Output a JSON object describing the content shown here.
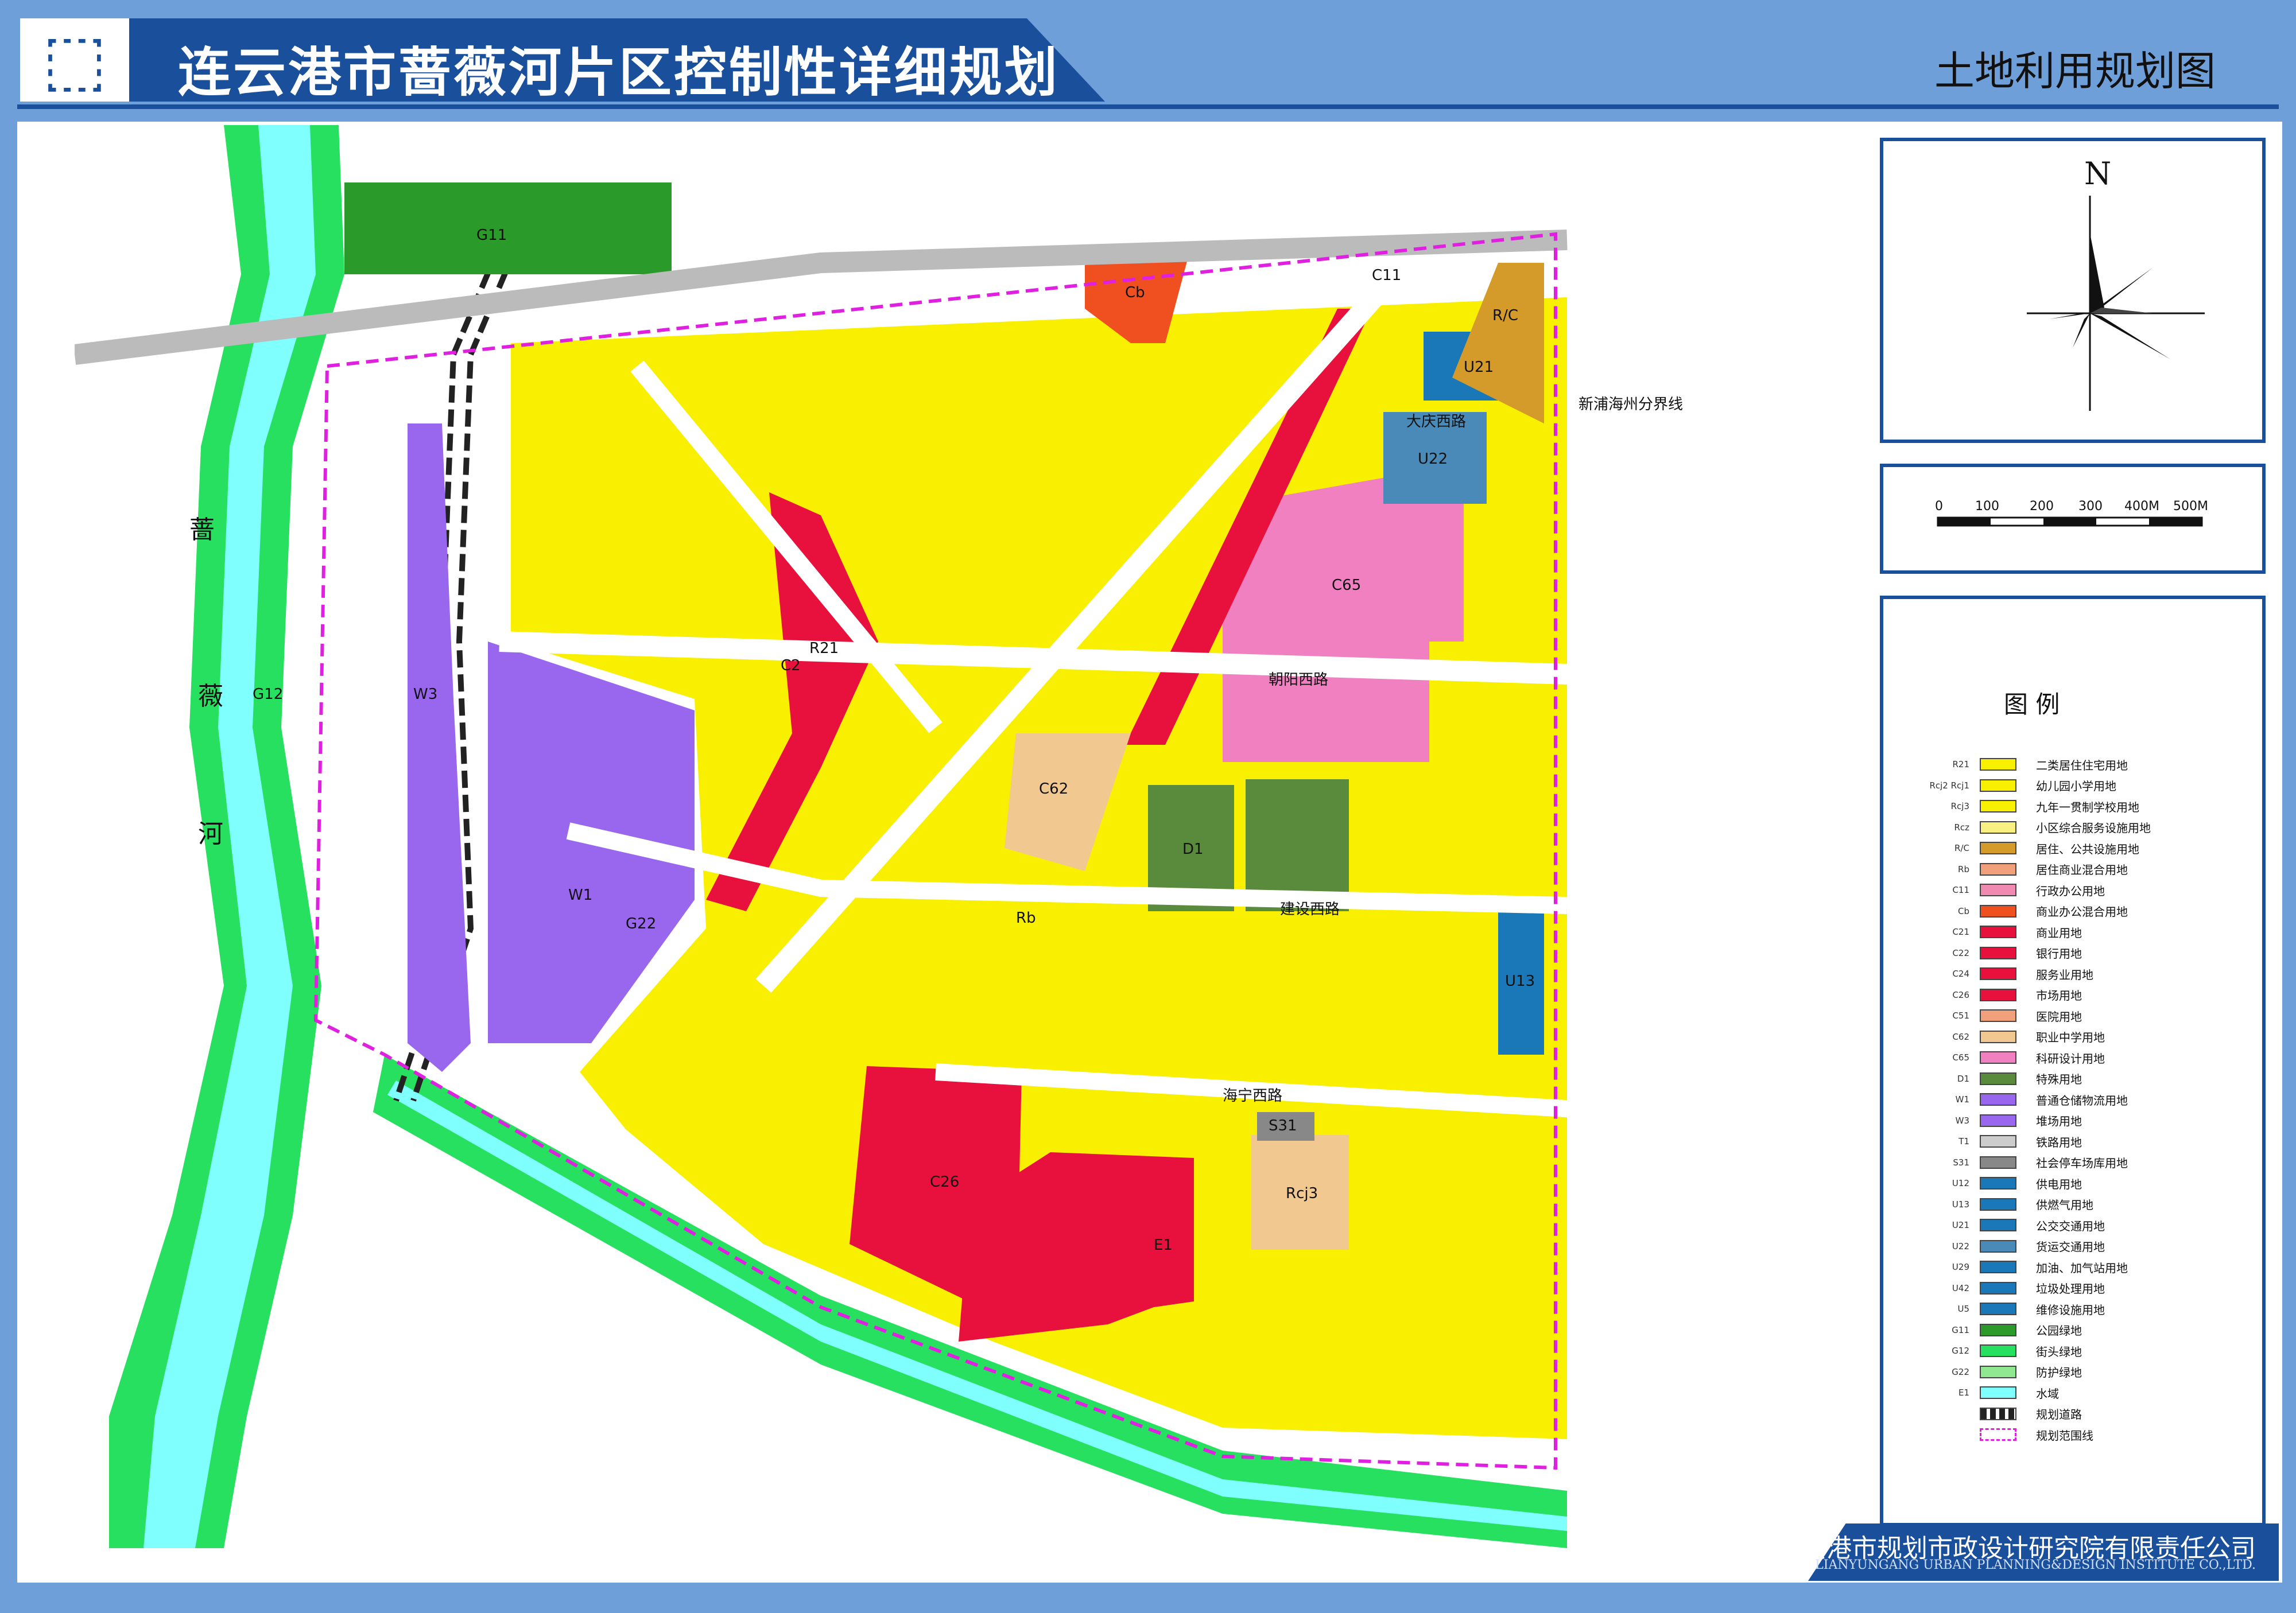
{
  "header": {
    "title": "连云港市蔷薇河片区控制性详细规划",
    "subtitle": "土地利用规划图"
  },
  "north": {
    "label": "N"
  },
  "scale": {
    "ticks": [
      "0",
      "100",
      "200",
      "300",
      "400M",
      "500M"
    ]
  },
  "legend": {
    "title": "图  例",
    "items": [
      {
        "code": "R21",
        "label": "二类居住住宅用地",
        "color": "#f8f000"
      },
      {
        "code": "Rcj2 Rcj1",
        "label": "幼儿园小学用地",
        "color": "#f8f000"
      },
      {
        "code": "Rcj3",
        "label": "九年一贯制学校用地",
        "color": "#f8f000"
      },
      {
        "code": "Rcz",
        "label": "小区综合服务设施用地",
        "color": "#f8f080"
      },
      {
        "code": "R/C",
        "label": "居住、公共设施用地",
        "color": "#d49a2a"
      },
      {
        "code": "Rb",
        "label": "居住商业混合用地",
        "color": "#f0a07a"
      },
      {
        "code": "C11",
        "label": "行政办公用地",
        "color": "#f08ab0"
      },
      {
        "code": "Cb",
        "label": "商业办公混合用地",
        "color": "#f05020"
      },
      {
        "code": "C21",
        "label": "商业用地",
        "color": "#e8103c"
      },
      {
        "code": "C22",
        "label": "银行用地",
        "color": "#e8103c"
      },
      {
        "code": "C24",
        "label": "服务业用地",
        "color": "#e8103c"
      },
      {
        "code": "C26",
        "label": "市场用地",
        "color": "#e8103c"
      },
      {
        "code": "C51",
        "label": "医院用地",
        "color": "#f0a07a"
      },
      {
        "code": "C62",
        "label": "职业中学用地",
        "color": "#f0c890"
      },
      {
        "code": "C65",
        "label": "科研设计用地",
        "color": "#f080c0"
      },
      {
        "code": "D1",
        "label": "特殊用地",
        "color": "#5a8a3c"
      },
      {
        "code": "W1",
        "label": "普通仓储物流用地",
        "color": "#9966ee"
      },
      {
        "code": "W3",
        "label": "堆场用地",
        "color": "#9966ee"
      },
      {
        "code": "T1",
        "label": "铁路用地",
        "color": "#cccccc"
      },
      {
        "code": "S31",
        "label": "社会停车场库用地",
        "color": "#888888"
      },
      {
        "code": "U12",
        "label": "供电用地",
        "color": "#1a78b8"
      },
      {
        "code": "U13",
        "label": "供燃气用地",
        "color": "#1a78b8"
      },
      {
        "code": "U21",
        "label": "公交交通用地",
        "color": "#1a78b8"
      },
      {
        "code": "U22",
        "label": "货运交通用地",
        "color": "#4a8ab8"
      },
      {
        "code": "U29",
        "label": "加油、加气站用地",
        "color": "#1a78b8"
      },
      {
        "code": "U42",
        "label": "垃圾处理用地",
        "color": "#1a78b8"
      },
      {
        "code": "U5",
        "label": "维修设施用地",
        "color": "#1a78b8"
      },
      {
        "code": "G11",
        "label": "公园绿地",
        "color": "#2a9a2a"
      },
      {
        "code": "G12",
        "label": "街头绿地",
        "color": "#28e060"
      },
      {
        "code": "G22",
        "label": "防护绿地",
        "color": "#90e890"
      },
      {
        "code": "E1",
        "label": "水域",
        "color": "#80ffff"
      },
      {
        "code": "",
        "label": "规划道路",
        "color": "#666666"
      },
      {
        "code": "",
        "label": "规划范围线",
        "color": "#e020e0"
      }
    ]
  },
  "map": {
    "river_name": [
      "蔷",
      "薇",
      "河"
    ],
    "road_labels": [
      "朝阳西路",
      "建设西路",
      "海宁西路",
      "大庆西路"
    ],
    "boundary_label": "新浦海州分界线",
    "zones": [
      {
        "code": "R21"
      },
      {
        "code": "Rb"
      },
      {
        "code": "C11"
      },
      {
        "code": "Cb"
      },
      {
        "code": "C2"
      },
      {
        "code": "C26"
      },
      {
        "code": "C65"
      },
      {
        "code": "C62"
      },
      {
        "code": "D1"
      },
      {
        "code": "W1"
      },
      {
        "code": "W3"
      },
      {
        "code": "G11"
      },
      {
        "code": "G12"
      },
      {
        "code": "G22"
      },
      {
        "code": "E1"
      },
      {
        "code": "U21"
      },
      {
        "code": "U22"
      },
      {
        "code": "U13"
      },
      {
        "code": "R/C"
      },
      {
        "code": "Rcj3"
      },
      {
        "code": "S31"
      }
    ]
  },
  "footer": {
    "company_cn": "连云港市规划市政设计研究院有限责任公司",
    "company_en": "LIANYUNGANG URBAN PLANNING&DESIGN INSTITUTE CO.,LTD."
  }
}
